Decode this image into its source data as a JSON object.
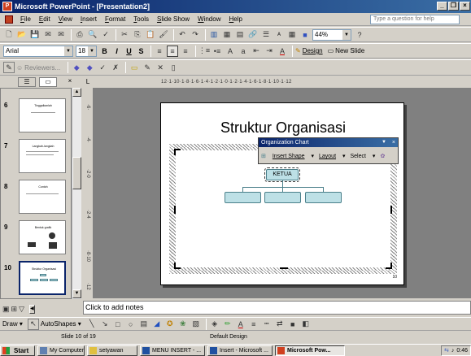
{
  "window": {
    "title": "Microsoft PowerPoint - [Presentation2]",
    "app_icon": "powerpoint-icon"
  },
  "menu": {
    "items": [
      "File",
      "Edit",
      "View",
      "Insert",
      "Format",
      "Tools",
      "Slide Show",
      "Window",
      "Help"
    ],
    "help_placeholder": "Type a question for help"
  },
  "standard_toolbar": {
    "zoom": "44%"
  },
  "formatting_toolbar": {
    "font": "Arial",
    "size": "18",
    "design_label": "Design",
    "new_slide_label": "New Slide"
  },
  "review_toolbar": {
    "reviewers_label": "Reviewers..."
  },
  "ruler": {
    "horizontal": "12·1·10·1·8·1·6·1·4·1·2·1·0·1·2·1·4·1·6·1·8·1·10·1·12"
  },
  "thumbnails": [
    {
      "num": "6",
      "title": "Tinggalkanlah"
    },
    {
      "num": "7",
      "title": "Langkah-langkah"
    },
    {
      "num": "8",
      "title": "Contoh"
    },
    {
      "num": "9",
      "title": "Bentuk grafik"
    },
    {
      "num": "10",
      "title": "Struktur Organisasi"
    }
  ],
  "slide": {
    "title": "Struktur Organisasi",
    "root_box": "KETUA",
    "slide_number": "10"
  },
  "org_toolbar": {
    "title": "Organization Chart",
    "insert_shape": "Insert Shape",
    "layout": "Layout",
    "select": "Select"
  },
  "notes": {
    "placeholder": "Click to add notes"
  },
  "drawing_toolbar": {
    "draw_label": "Draw",
    "autoshapes_label": "AutoShapes"
  },
  "status": {
    "slide": "Slide 10 of 19",
    "design": "Default Design"
  },
  "taskbar": {
    "start": "Start",
    "tasks": [
      "My Computer",
      "setyawan",
      "MENU INSERT - ...",
      "Insert - Microsoft ...",
      "Microsoft Pow..."
    ],
    "clock": "0:46"
  }
}
